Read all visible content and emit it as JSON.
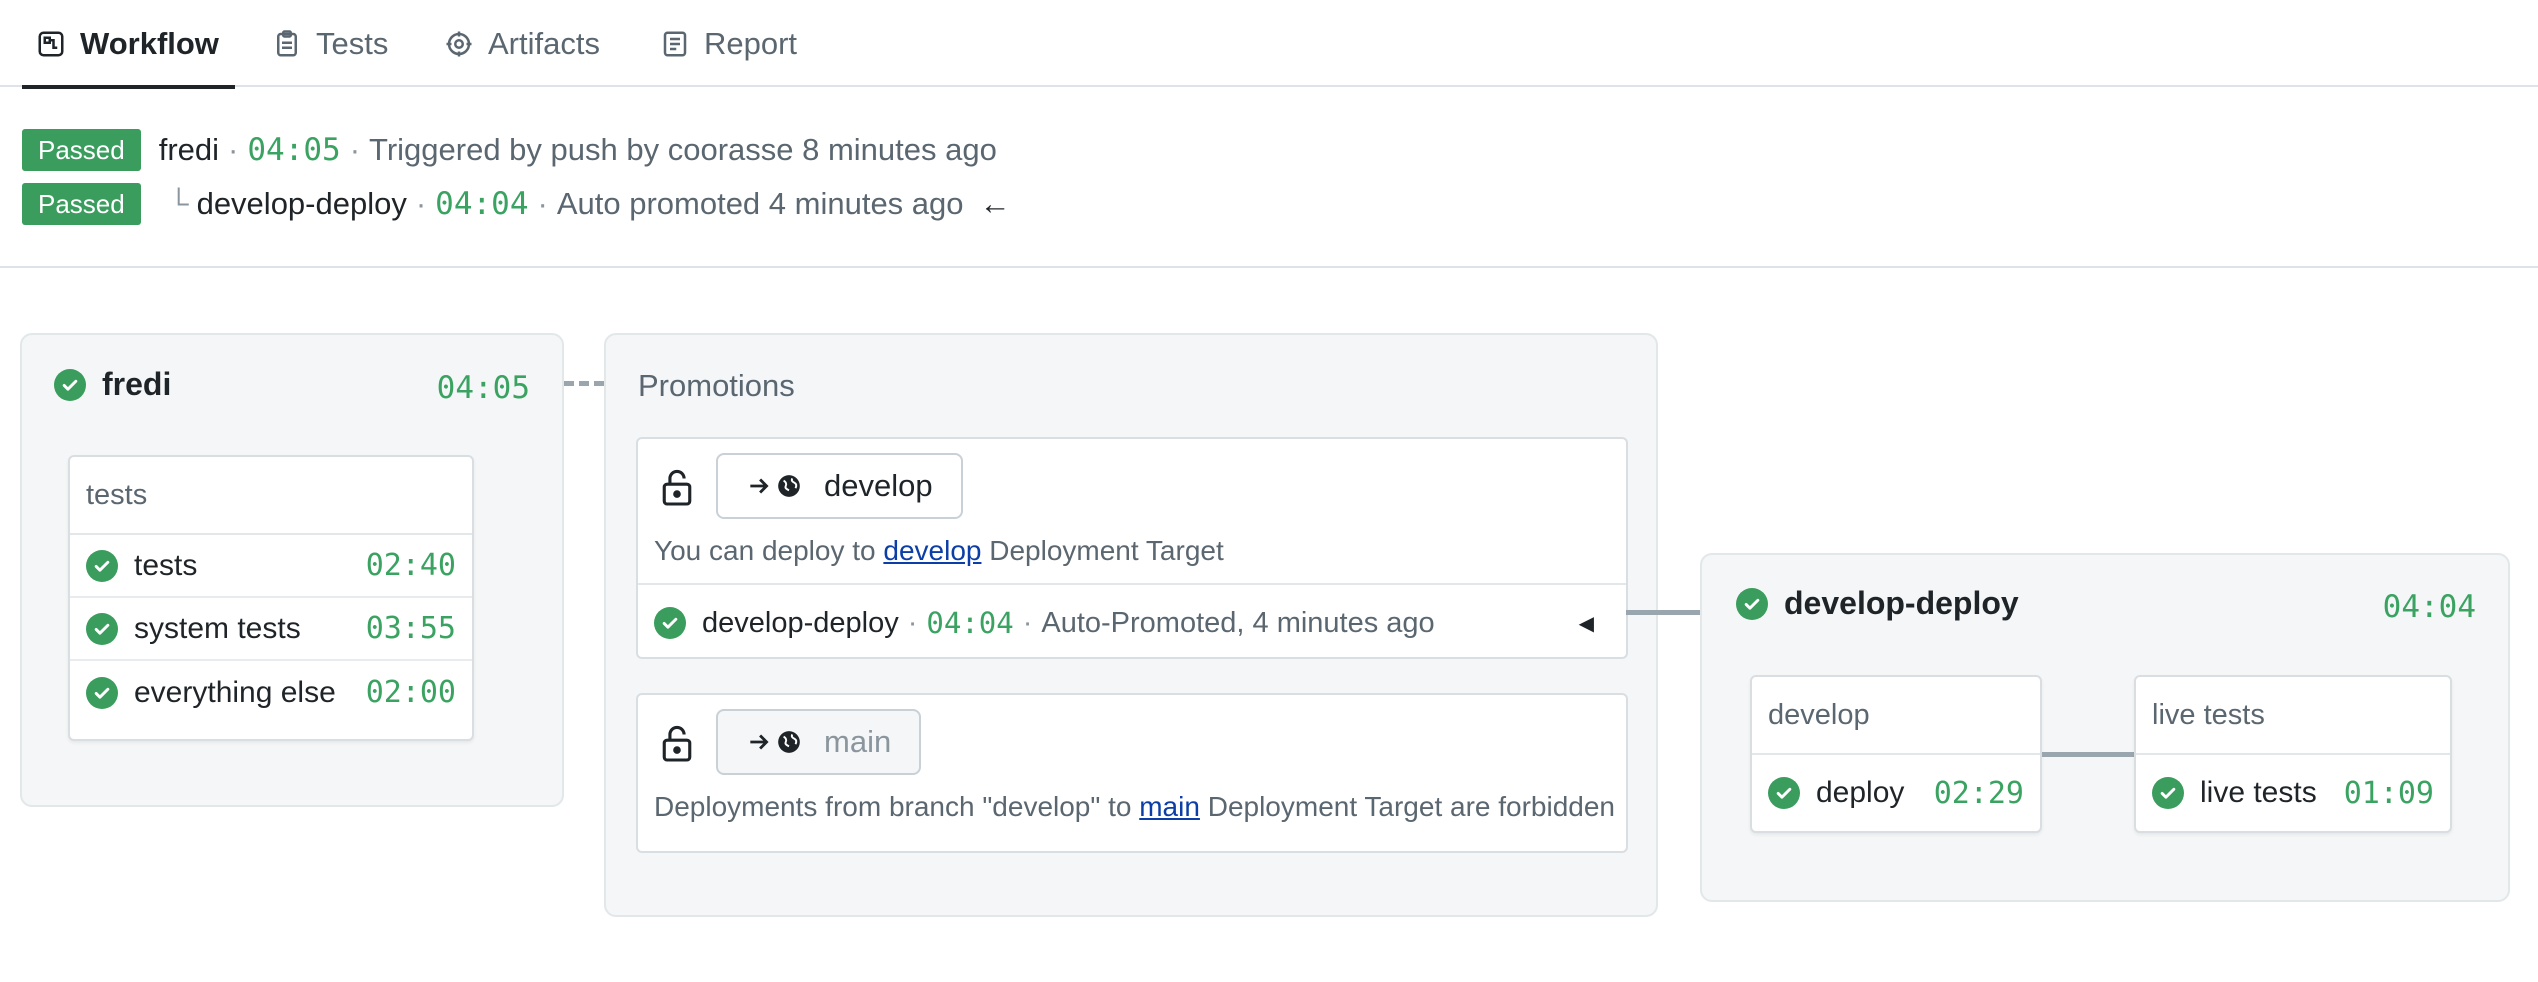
{
  "tabs": [
    {
      "label": "Workflow",
      "icon": "workflow-icon",
      "active": true
    },
    {
      "label": "Tests",
      "icon": "clipboard-icon"
    },
    {
      "label": "Artifacts",
      "icon": "artifacts-icon"
    },
    {
      "label": "Report",
      "icon": "report-icon"
    }
  ],
  "status": {
    "line1": {
      "badge": "Passed",
      "name": "fredi",
      "time": "04:05",
      "text": "Triggered by push by coorasse 8 minutes ago"
    },
    "line2": {
      "badge": "Passed",
      "tree": "└",
      "name": "develop-deploy",
      "time": "04:04",
      "text": "Auto promoted 4 minutes ago",
      "arrow": "←"
    }
  },
  "pipeline": {
    "name": "fredi",
    "time": "04:05",
    "block": {
      "title": "tests",
      "jobs": [
        {
          "name": "tests",
          "time": "02:40"
        },
        {
          "name": "system tests",
          "time": "03:55"
        },
        {
          "name": "everything else",
          "time": "02:00"
        }
      ]
    }
  },
  "promotions": {
    "title": "Promotions",
    "develop": {
      "target": "develop",
      "text_before": "You can deploy to",
      "link": "develop",
      "text_after": "Deployment Target",
      "run_name": "develop-deploy",
      "run_time": "04:04",
      "run_text": "Auto-Promoted, 4 minutes ago",
      "caret": "◀"
    },
    "main": {
      "target": "main",
      "text_before": "Deployments from branch \"develop\" to",
      "link": "main",
      "text_after": "Deployment Target are forbidden"
    }
  },
  "deploy_pipeline": {
    "name": "develop-deploy",
    "time": "04:04",
    "blocks": [
      {
        "title": "develop",
        "job": "deploy",
        "time": "02:29"
      },
      {
        "title": "live tests",
        "job": "live tests",
        "time": "01:09"
      }
    ]
  },
  "colors": {
    "passed": "#3a9d5d",
    "time": "#3aa361",
    "link": "#0b3ea6"
  }
}
